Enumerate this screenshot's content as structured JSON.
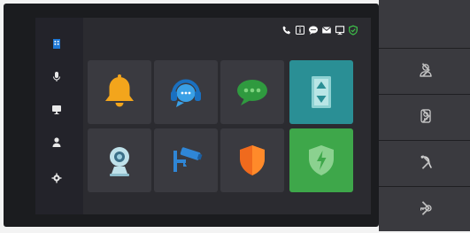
{
  "sidebar": {
    "items": [
      {
        "icon": "building-icon"
      },
      {
        "icon": "microphone-icon"
      },
      {
        "icon": "monitor-icon"
      },
      {
        "icon": "user-icon"
      },
      {
        "icon": "gear-icon"
      }
    ]
  },
  "status_bar": {
    "icons": [
      "phone-icon",
      "info-icon",
      "message-icon",
      "mail-icon",
      "screen-icon",
      "shield-icon"
    ]
  },
  "tiles": [
    {
      "name": "bell-tile",
      "icon": "bell-icon"
    },
    {
      "name": "headset-tile",
      "icon": "headset-icon"
    },
    {
      "name": "chat-tile",
      "icon": "chat-icon"
    },
    {
      "name": "elevator-tile",
      "icon": "elevator-icon"
    },
    {
      "name": "indoor-camera-tile",
      "icon": "camera-icon"
    },
    {
      "name": "cctv-tile",
      "icon": "cctv-icon"
    },
    {
      "name": "alarm-shield-tile",
      "icon": "shield-icon"
    },
    {
      "name": "arm-tile",
      "icon": "shield-lightning-icon"
    }
  ],
  "right_panel": {
    "buttons": [
      "user-call-icon",
      "doorbell-icon",
      "handset-icon",
      "key-icon"
    ]
  },
  "colors": {
    "bell": "#f3a51c",
    "headset": "#3aa0e6",
    "chat": "#2f9a3f",
    "elevator_bg": "#2a8f95",
    "camera": "#bfe1ea",
    "cctv": "#2f86d6",
    "shield_orange": "#f06a1d",
    "arm_bg": "#3ea74a"
  }
}
